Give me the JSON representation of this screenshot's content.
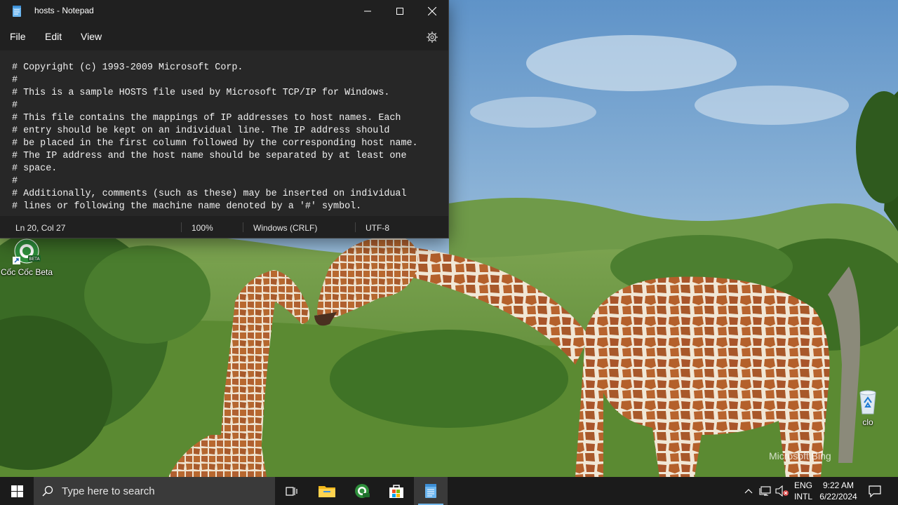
{
  "window": {
    "title": "hosts - Notepad",
    "menu": [
      "File",
      "Edit",
      "View"
    ],
    "content": "# Copyright (c) 1993-2009 Microsoft Corp.\n#\n# This is a sample HOSTS file used by Microsoft TCP/IP for Windows.\n#\n# This file contains the mappings of IP addresses to host names. Each\n# entry should be kept on an individual line. The IP address should\n# be placed in the first column followed by the corresponding host name.\n# The IP address and the host name should be separated by at least one\n# space.\n#\n# Additionally, comments (such as these) may be inserted on individual\n# lines or following the machine name denoted by a '#' symbol.",
    "status": {
      "position": "Ln 20, Col 27",
      "zoom": "100%",
      "line_ending": "Windows (CRLF)",
      "encoding": "UTF-8"
    }
  },
  "desktop": {
    "icons": [
      {
        "label": "Cốc Cốc Beta",
        "icon": "coccoc-beta-icon",
        "badge": "BETA"
      },
      {
        "label": "clo",
        "icon": "recycle-bin-icon"
      }
    ],
    "watermark": "Microsoft Bing"
  },
  "taskbar": {
    "search_placeholder": "Type here to search",
    "apps": [
      "task-view-icon",
      "file-explorer-icon",
      "coccoc-icon",
      "microsoft-store-icon",
      "notepad-icon"
    ],
    "tray": {
      "lang_top": "ENG",
      "lang_bottom": "INTL",
      "time": "9:22 AM",
      "date": "6/22/2024"
    }
  },
  "colors": {
    "window_bg": "#202020",
    "editor_bg": "#272727",
    "taskbar_bg": "#1b1b1b",
    "search_bg": "#3a3a3a",
    "accent": "#76b9ed"
  }
}
